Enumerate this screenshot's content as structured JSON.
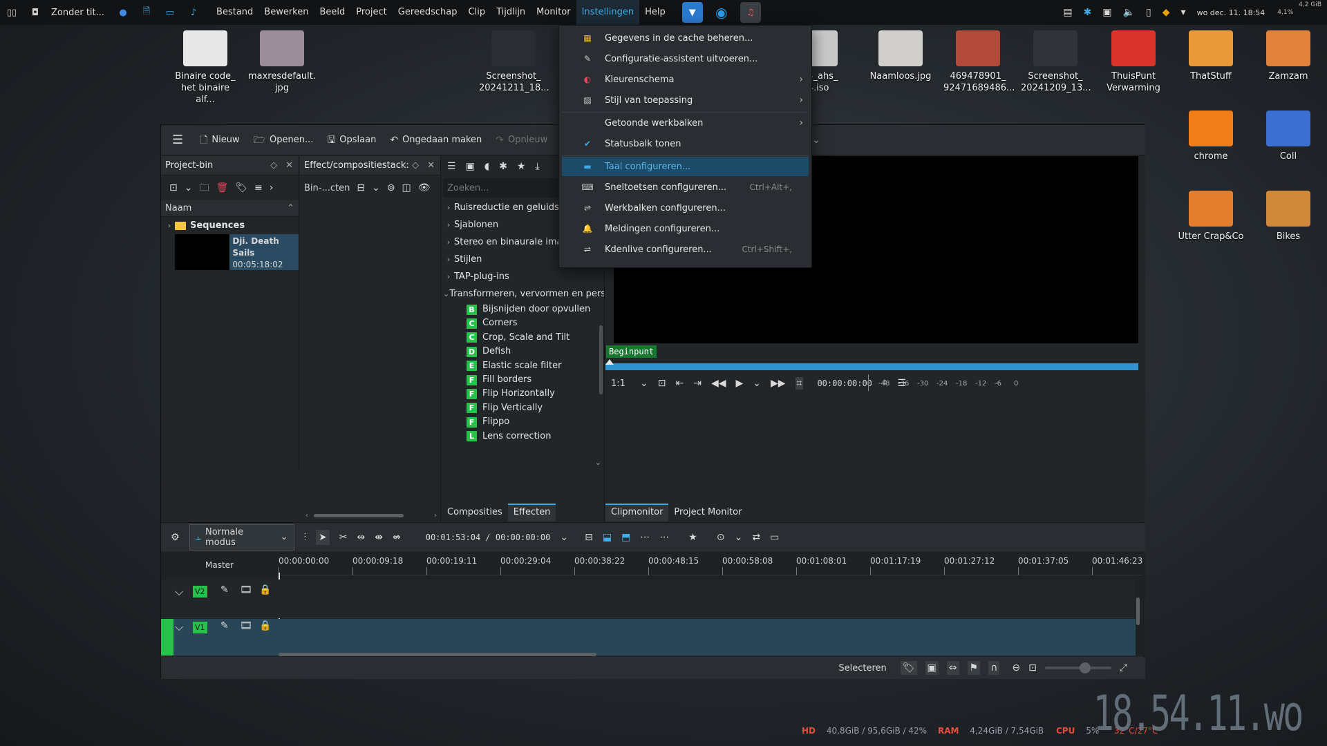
{
  "taskbar": {
    "window_title": "Zonder tit...",
    "menu": [
      "Bestand",
      "Bewerken",
      "Beeld",
      "Project",
      "Gereedschap",
      "Clip",
      "Tijdlijn",
      "Monitor",
      "Instellingen",
      "Help"
    ],
    "active_menu": "Instellingen",
    "tray_clock": "wo dec. 11. 18:54",
    "cpu_mini": "4,1%",
    "mem_mini": "4,2 GiB"
  },
  "desktop_icons": [
    {
      "label": "Binaire code_ het binaire alf...",
      "color": "#e8e8e8"
    },
    {
      "label": "maxresdefault. jpg",
      "color": "#9a8c99"
    },
    {
      "label": "Screenshot_ 20241211_18...",
      "color": "#2a2d33"
    },
    {
      "label": "23.4_ahs_ 64.iso",
      "color": "#c8c8c8"
    },
    {
      "label": "Naamloos.jpg",
      "color": "#d0cfcb"
    },
    {
      "label": "469478901_ 92471689486...",
      "color": "#b14a3a"
    },
    {
      "label": "Screenshot_ 20241209_13...",
      "color": "#303338"
    },
    {
      "label": "ThuisPunt Verwarming",
      "color": "#d9342b"
    },
    {
      "label": "ThatStuff",
      "color": "#e89a3a"
    },
    {
      "label": "Zamzam",
      "color": "#e0813c"
    },
    {
      "label": "chrome",
      "color": "#ef7d1a"
    },
    {
      "label": "Coll",
      "color": "#3c6fd0"
    },
    {
      "label": "Utter Crap&Co",
      "color": "#e47d2e"
    },
    {
      "label": "Bikes",
      "color": "#d0893a"
    }
  ],
  "toolbar": {
    "new": "Nieuw",
    "open": "Openen...",
    "save": "Opslaan",
    "undo": "Ongedaan maken",
    "redo": "Opnieuw"
  },
  "project_bin": {
    "title": "Project-bin",
    "column": "Naam",
    "folder": "Sequences",
    "clip_name": "Dji. Death Sails",
    "clip_duration": "00:05:18:02"
  },
  "effect_stack": {
    "title": "Effect/compositiestack:",
    "bin_label": "Bin-...cten"
  },
  "effects": {
    "search_placeholder": "Zoeken...",
    "categories": [
      "Ruisreductie en geluidsre",
      "Sjablonen",
      "Stereo en binaurale imag",
      "Stijlen",
      "TAP-plug-ins",
      "Transformeren, vervormen en perspectief"
    ],
    "items": [
      {
        "badge": "B",
        "name": "Bijsnijden door opvullen"
      },
      {
        "badge": "C",
        "name": "Corners"
      },
      {
        "badge": "C",
        "name": "Crop, Scale and Tilt"
      },
      {
        "badge": "D",
        "name": "Defish"
      },
      {
        "badge": "E",
        "name": "Elastic scale filter"
      },
      {
        "badge": "F",
        "name": "Fill borders"
      },
      {
        "badge": "F",
        "name": "Flip Horizontally"
      },
      {
        "badge": "F",
        "name": "Flip Vertically"
      },
      {
        "badge": "F",
        "name": "Flippo"
      },
      {
        "badge": "L",
        "name": "Lens correction"
      }
    ],
    "tabs": [
      "Composities",
      "Effecten"
    ],
    "active_tab": "Effecten"
  },
  "monitor": {
    "in_point": "Beginpunt",
    "zoom": "1:1",
    "timecode": "00:00:00:00",
    "vu_scale": [
      "-48",
      "-36",
      "-30",
      "-24",
      "-18",
      "-12",
      "-6",
      "0"
    ],
    "tabs": [
      "Clipmonitor",
      "Project Monitor"
    ],
    "active_tab": "Clipmonitor"
  },
  "settings_menu": [
    {
      "label": "Gegevens in de cache beheren...",
      "icon": "cache-icon",
      "shortcut": "",
      "submenu": false
    },
    {
      "label": "Configuratie-assistent uitvoeren...",
      "icon": "wizard-icon",
      "shortcut": "",
      "submenu": false
    },
    {
      "label": "Kleurenschema",
      "icon": "color-scheme-icon",
      "shortcut": "",
      "submenu": true
    },
    {
      "label": "Stijl van toepassing",
      "icon": "style-icon",
      "shortcut": "",
      "submenu": true
    },
    {
      "label": "Getoonde werkbalken",
      "icon": "",
      "shortcut": "",
      "submenu": true
    },
    {
      "label": "Statusbalk tonen",
      "icon": "check-icon",
      "shortcut": "",
      "submenu": false
    },
    {
      "label": "Taal configureren...",
      "icon": "language-icon",
      "shortcut": "",
      "submenu": false
    },
    {
      "label": "Sneltoetsen configureren...",
      "icon": "keyboard-icon",
      "shortcut": "Ctrl+Alt+,",
      "submenu": false
    },
    {
      "label": "Werkbalken configureren...",
      "icon": "toolbar-config-icon",
      "shortcut": "",
      "submenu": false
    },
    {
      "label": "Meldingen configureren...",
      "icon": "bell-icon",
      "shortcut": "",
      "submenu": false
    },
    {
      "label": "Kdenlive configureren...",
      "icon": "settings-icon",
      "shortcut": "Ctrl+Shift+,",
      "submenu": false
    }
  ],
  "timeline": {
    "mode": "Normale modus",
    "timecode": "00:01:53:04 / 00:00:00:00",
    "master": "Master",
    "ruler": [
      "00:00:00:00",
      "00:00:09:18",
      "00:00:19:11",
      "00:00:29:04",
      "00:00:38:22",
      "00:00:48:15",
      "00:00:58:08",
      "00:01:08:01",
      "00:01:17:19",
      "00:01:27:12",
      "00:01:37:05",
      "00:01:46:23"
    ],
    "tracks": [
      "V2",
      "V1"
    ]
  },
  "statusbar": {
    "select": "Selecteren"
  },
  "sysinfo": {
    "hd_label": "HD",
    "hd_value": "40,8GiB / 95,6GiB / 42%",
    "ram_label": "RAM",
    "ram_value": "4,24GiB / 7,54GiB",
    "cpu_label": "CPU",
    "cpu_value": "5%",
    "temp": "32°C/27°C",
    "big_clock": "18.54.11.wo"
  },
  "colors": {
    "accent": "#3daee9",
    "badge_green": "#27c24c",
    "highlight": "#1d4a66",
    "track_v1": "#284656"
  }
}
